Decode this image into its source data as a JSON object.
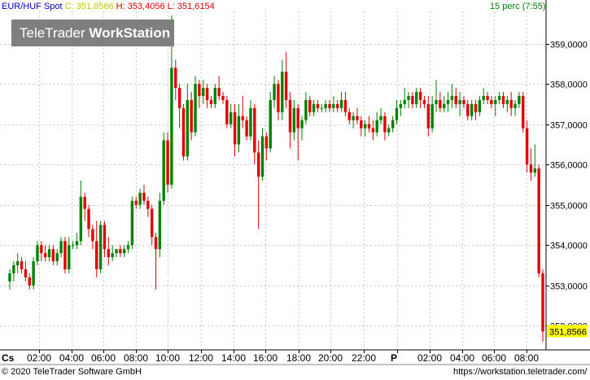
{
  "header": {
    "symbol": "EUR/HUF Spot",
    "close": "C: 351,8566",
    "high": "H: 353,4056",
    "low": "L: 351,6154",
    "interval": "15 perc (7:55)"
  },
  "watermark": {
    "brand": "TeleTrader",
    "product": "WorkStation"
  },
  "footer": {
    "copyright": "© 2020 TeleTrader Software GmbH",
    "url": "https://workstation.teletrader.com/"
  },
  "colors": {
    "up": "#008000",
    "down": "#e00000",
    "grid": "#c8c8c8",
    "header_symbol": "#0000c0",
    "header_close": "#c8c800",
    "header_high_low": "#e00000",
    "header_interval": "#008000",
    "price_box": "#ffff00"
  },
  "chart_data": {
    "type": "candlestick",
    "title": "EUR/HUF Spot",
    "ylim": [
      351.4,
      359.8
    ],
    "y_ticks": [
      352,
      353,
      354,
      355,
      356,
      357,
      358,
      359
    ],
    "y_tick_labels": [
      "352,0000",
      "353,0000",
      "354,0000",
      "355,0000",
      "356,0000",
      "357,0000",
      "358,0000",
      "359,0000"
    ],
    "x_tick_labels": [
      "Cs",
      "02:00",
      "04:00",
      "06:00",
      "08:00",
      "10:00",
      "12:00",
      "14:00",
      "16:00",
      "18:00",
      "20:00",
      "22:00",
      "P",
      "02:00",
      "04:00",
      "06:00",
      "08:00"
    ],
    "last_price": 351.8566,
    "last_price_label": "351,8566",
    "candles": [
      [
        353.1,
        353.4,
        352.9,
        353.3
      ],
      [
        353.3,
        353.6,
        353.1,
        353.5
      ],
      [
        353.5,
        353.8,
        353.3,
        353.6
      ],
      [
        353.6,
        353.7,
        353.3,
        353.4
      ],
      [
        353.4,
        353.6,
        353.1,
        353.2
      ],
      [
        353.2,
        353.3,
        352.9,
        353.0
      ],
      [
        353.0,
        353.7,
        352.9,
        353.6
      ],
      [
        353.6,
        354.1,
        353.5,
        354.0
      ],
      [
        354.0,
        354.1,
        353.6,
        353.8
      ],
      [
        353.8,
        354.0,
        353.6,
        353.7
      ],
      [
        353.7,
        354.0,
        353.6,
        353.9
      ],
      [
        353.9,
        354.0,
        353.5,
        353.6
      ],
      [
        353.6,
        353.9,
        353.5,
        353.8
      ],
      [
        353.8,
        354.2,
        353.7,
        354.1
      ],
      [
        354.1,
        354.2,
        353.3,
        353.4
      ],
      [
        353.4,
        354.2,
        353.3,
        354.0
      ],
      [
        354.0,
        354.1,
        353.9,
        354.0
      ],
      [
        354.0,
        354.3,
        353.9,
        354.1
      ],
      [
        354.1,
        355.6,
        354.0,
        355.2
      ],
      [
        355.2,
        355.3,
        354.6,
        354.9
      ],
      [
        354.9,
        355.0,
        354.2,
        354.4
      ],
      [
        354.4,
        354.5,
        353.9,
        354.1
      ],
      [
        354.1,
        354.6,
        353.2,
        353.4
      ],
      [
        353.4,
        354.6,
        353.3,
        354.5
      ],
      [
        354.5,
        354.6,
        353.7,
        353.9
      ],
      [
        353.9,
        354.2,
        353.5,
        353.7
      ],
      [
        353.7,
        354.0,
        353.6,
        353.8
      ],
      [
        353.8,
        353.9,
        353.7,
        353.9
      ],
      [
        353.9,
        354.0,
        353.7,
        353.8
      ],
      [
        353.8,
        354.0,
        353.7,
        353.9
      ],
      [
        353.9,
        354.1,
        353.8,
        354.0
      ],
      [
        354.0,
        355.2,
        353.9,
        355.1
      ],
      [
        355.1,
        355.2,
        354.9,
        355.0
      ],
      [
        355.0,
        355.4,
        354.9,
        355.3
      ],
      [
        355.3,
        355.5,
        355.0,
        355.1
      ],
      [
        355.1,
        355.2,
        354.7,
        354.9
      ],
      [
        354.9,
        355.0,
        354.0,
        354.2
      ],
      [
        354.2,
        354.3,
        352.9,
        353.9
      ],
      [
        353.9,
        355.3,
        353.7,
        355.1
      ],
      [
        355.1,
        356.8,
        355.0,
        356.6
      ],
      [
        356.6,
        356.8,
        355.3,
        355.5
      ],
      [
        355.5,
        359.7,
        355.4,
        358.4
      ],
      [
        358.4,
        358.6,
        357.6,
        357.9
      ],
      [
        357.9,
        358.0,
        356.9,
        357.4
      ],
      [
        357.4,
        357.5,
        356.1,
        356.2
      ],
      [
        356.2,
        358.0,
        356.1,
        357.6
      ],
      [
        357.6,
        357.8,
        356.6,
        356.8
      ],
      [
        356.8,
        358.2,
        356.7,
        358.0
      ],
      [
        358.0,
        358.1,
        357.4,
        357.7
      ],
      [
        357.7,
        358.1,
        357.5,
        357.9
      ],
      [
        357.9,
        358.0,
        357.4,
        357.6
      ],
      [
        357.6,
        357.7,
        357.4,
        357.5
      ],
      [
        357.5,
        358.0,
        357.4,
        357.9
      ],
      [
        357.9,
        358.2,
        357.6,
        357.7
      ],
      [
        357.7,
        357.8,
        357.5,
        357.6
      ],
      [
        357.6,
        357.7,
        356.9,
        357.0
      ],
      [
        357.0,
        357.5,
        356.9,
        357.3
      ],
      [
        357.3,
        357.5,
        356.2,
        356.5
      ],
      [
        356.5,
        357.5,
        356.3,
        357.2
      ],
      [
        357.2,
        357.7,
        356.9,
        357.1
      ],
      [
        357.1,
        357.2,
        356.6,
        356.7
      ],
      [
        356.7,
        357.6,
        356.6,
        357.4
      ],
      [
        357.4,
        357.5,
        356.0,
        356.3
      ],
      [
        356.3,
        356.6,
        354.4,
        355.7
      ],
      [
        355.7,
        356.9,
        355.6,
        356.7
      ],
      [
        356.7,
        356.8,
        356.1,
        356.4
      ],
      [
        356.4,
        357.8,
        356.3,
        357.6
      ],
      [
        357.6,
        358.2,
        357.4,
        358.0
      ],
      [
        358.0,
        358.1,
        357.1,
        357.3
      ],
      [
        357.3,
        358.6,
        357.1,
        358.3
      ],
      [
        358.3,
        358.8,
        357.4,
        357.6
      ],
      [
        357.6,
        357.8,
        356.4,
        356.8
      ],
      [
        356.8,
        357.6,
        356.6,
        357.4
      ],
      [
        357.4,
        357.5,
        356.1,
        356.9
      ],
      [
        356.9,
        357.2,
        356.6,
        357.1
      ],
      [
        357.1,
        357.8,
        357.0,
        357.6
      ],
      [
        357.6,
        357.7,
        357.2,
        357.3
      ],
      [
        357.3,
        357.6,
        357.2,
        357.5
      ],
      [
        357.5,
        357.6,
        357.3,
        357.4
      ],
      [
        357.4,
        357.5,
        357.3,
        357.4
      ],
      [
        357.4,
        357.6,
        357.3,
        357.5
      ],
      [
        357.5,
        357.6,
        357.3,
        357.4
      ],
      [
        357.4,
        357.7,
        357.3,
        357.5
      ],
      [
        357.5,
        357.6,
        357.3,
        357.4
      ],
      [
        357.4,
        357.8,
        357.3,
        357.6
      ],
      [
        357.6,
        357.8,
        357.2,
        357.3
      ],
      [
        357.3,
        357.4,
        357.0,
        357.1
      ],
      [
        357.1,
        357.3,
        356.9,
        357.2
      ],
      [
        357.2,
        357.4,
        357.0,
        357.1
      ],
      [
        357.1,
        357.2,
        356.7,
        356.9
      ],
      [
        356.9,
        357.1,
        356.7,
        357.0
      ],
      [
        357.0,
        357.2,
        356.8,
        356.9
      ],
      [
        356.9,
        357.1,
        356.6,
        356.8
      ],
      [
        356.8,
        357.3,
        356.7,
        357.1
      ],
      [
        357.1,
        357.4,
        357.0,
        357.2
      ],
      [
        357.2,
        357.3,
        356.6,
        356.8
      ],
      [
        356.8,
        357.0,
        356.7,
        356.9
      ],
      [
        356.9,
        357.2,
        356.8,
        357.1
      ],
      [
        357.1,
        357.6,
        357.0,
        357.4
      ],
      [
        357.4,
        357.6,
        357.2,
        357.5
      ],
      [
        357.5,
        357.9,
        357.4,
        357.6
      ],
      [
        357.6,
        357.8,
        357.4,
        357.7
      ],
      [
        357.7,
        357.8,
        357.4,
        357.5
      ],
      [
        357.5,
        357.9,
        357.4,
        357.8
      ],
      [
        357.8,
        357.9,
        357.4,
        357.6
      ],
      [
        357.6,
        357.7,
        357.4,
        357.5
      ],
      [
        357.5,
        357.7,
        356.7,
        356.9
      ],
      [
        356.9,
        357.7,
        356.8,
        357.5
      ],
      [
        357.5,
        358.1,
        357.3,
        357.6
      ],
      [
        357.6,
        357.8,
        357.3,
        357.4
      ],
      [
        357.4,
        357.7,
        357.3,
        357.5
      ],
      [
        357.5,
        357.8,
        357.3,
        357.6
      ],
      [
        357.6,
        358.0,
        357.4,
        357.7
      ],
      [
        357.7,
        357.9,
        357.4,
        357.5
      ],
      [
        357.5,
        357.8,
        357.2,
        357.6
      ],
      [
        357.6,
        357.7,
        357.4,
        357.5
      ],
      [
        357.5,
        357.6,
        357.1,
        357.2
      ],
      [
        357.2,
        357.6,
        357.1,
        357.5
      ],
      [
        357.5,
        357.6,
        357.1,
        357.3
      ],
      [
        357.3,
        357.7,
        357.2,
        357.6
      ],
      [
        357.6,
        357.9,
        357.5,
        357.7
      ],
      [
        357.7,
        357.8,
        357.5,
        357.6
      ],
      [
        357.6,
        357.7,
        357.4,
        357.5
      ],
      [
        357.5,
        357.7,
        357.2,
        357.6
      ],
      [
        357.6,
        357.8,
        357.5,
        357.7
      ],
      [
        357.7,
        357.8,
        357.4,
        357.5
      ],
      [
        357.5,
        357.7,
        357.3,
        357.6
      ],
      [
        357.6,
        357.8,
        357.2,
        357.4
      ],
      [
        357.4,
        357.6,
        357.2,
        357.5
      ],
      [
        357.5,
        357.8,
        357.4,
        357.7
      ],
      [
        357.7,
        357.8,
        356.8,
        356.9
      ],
      [
        356.9,
        357.1,
        355.8,
        356.0
      ],
      [
        356.0,
        356.4,
        355.6,
        355.8
      ],
      [
        355.8,
        356.5,
        355.7,
        355.9
      ],
      [
        355.9,
        356.0,
        353.2,
        353.3
      ],
      [
        353.3,
        353.4,
        351.6,
        351.8566
      ]
    ]
  }
}
